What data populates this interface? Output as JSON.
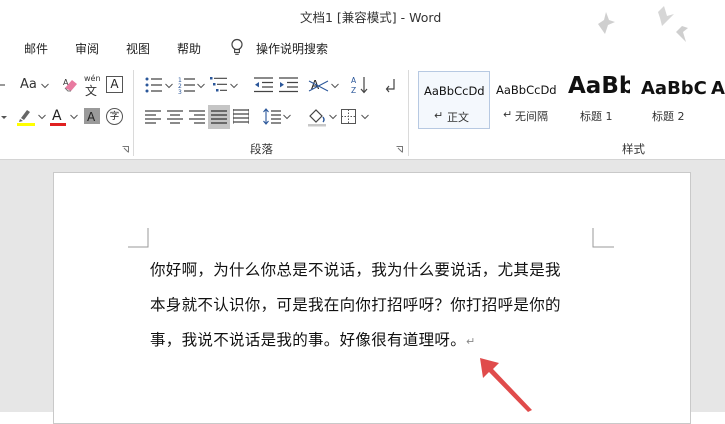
{
  "window": {
    "title": "文档1 [兼容模式]  -  Word"
  },
  "menu": {
    "items": [
      "邮件",
      "审阅",
      "视图",
      "帮助"
    ],
    "tell_me": "操作说明搜索"
  },
  "ribbon": {
    "groups": {
      "paragraph": "段落",
      "styles": "样式"
    },
    "font": {
      "case_label": "Aa",
      "phonetic_label": "wén",
      "phonetic_char": "文",
      "border_char": "A",
      "enclose_char": "字"
    },
    "styles": [
      {
        "preview": "AaBbCcDd",
        "name": "正文",
        "selected": true
      },
      {
        "preview": "AaBbCcDd",
        "name": "无间隔",
        "selected": false
      },
      {
        "preview": "AaBb",
        "name": "标题 1",
        "selected": false
      },
      {
        "preview": "AaBbC",
        "name": "标题 2",
        "selected": false
      },
      {
        "preview": "A",
        "name": "",
        "selected": false
      }
    ]
  },
  "document": {
    "lines": [
      "你好啊，为什么你总是不说话，我为什么要说话，尤其是我",
      "本身就不认识你，可是我在向你打招呼呀？你打招呼是你的",
      "事，我说不说话是我的事。好像很有道理呀。"
    ],
    "paragraph_mark": "↵"
  },
  "colors": {
    "accent": "#2b579a",
    "highlight": "#ffff00",
    "font_color": "#e02020",
    "arrow": "#e04b4b"
  }
}
